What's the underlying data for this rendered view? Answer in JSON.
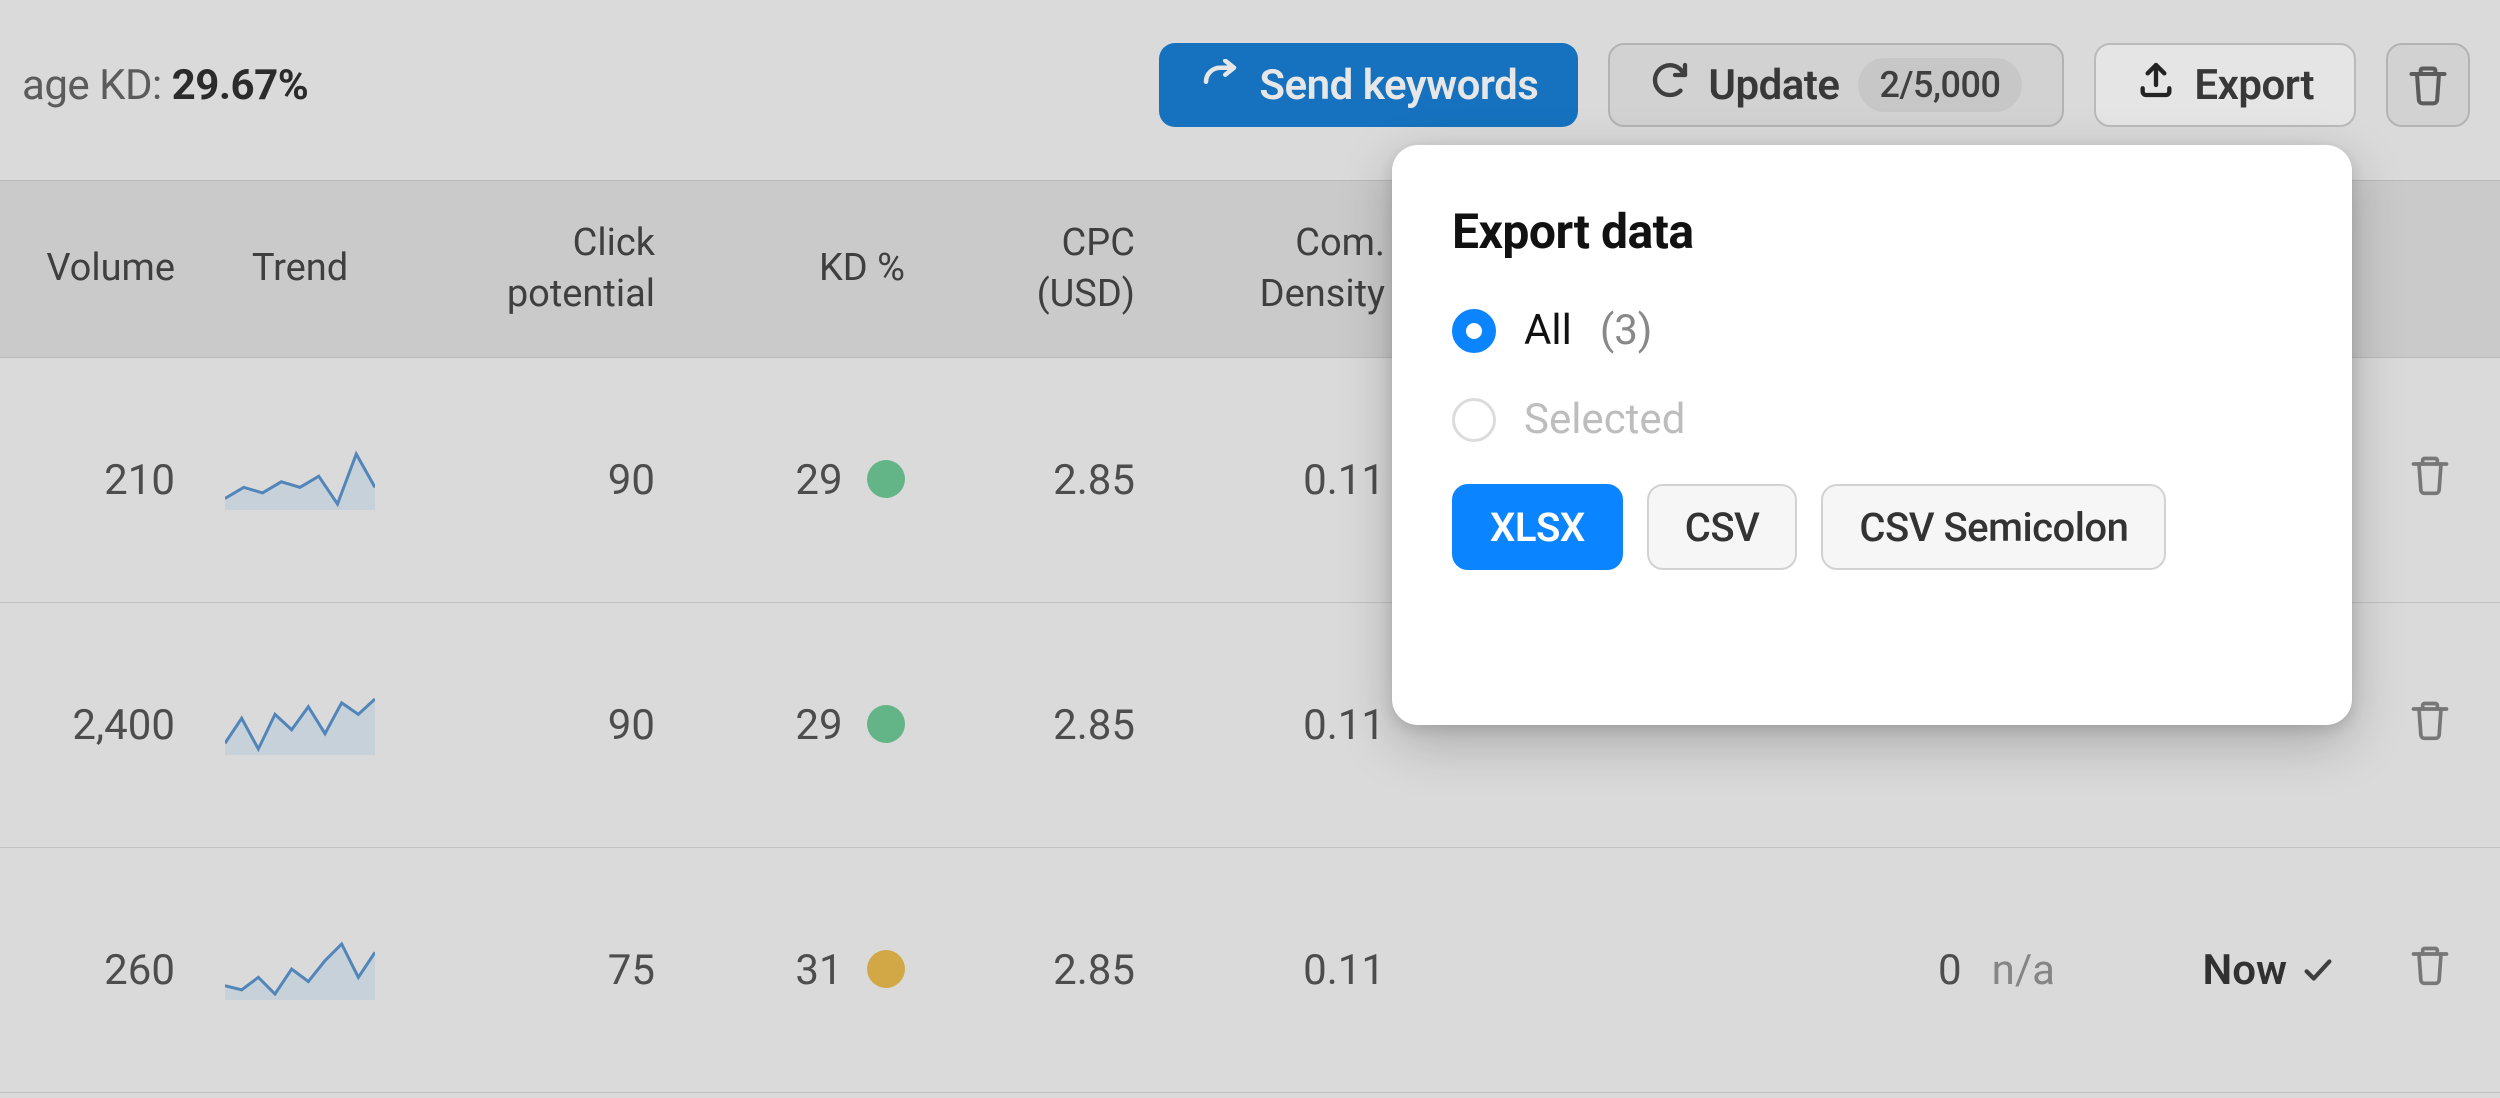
{
  "header": {
    "avg_kd_label": "age KD: ",
    "avg_kd_value": "29.67%"
  },
  "toolbar": {
    "send_label": "Send keywords",
    "update_label": "Update",
    "update_count": "2/5,000",
    "export_label": "Export"
  },
  "columns": {
    "volume": "Volume",
    "trend": "Trend",
    "click": "Click potential",
    "kd": "KD %",
    "cpc": "CPC (USD)",
    "com": "Com. Density"
  },
  "rows": [
    {
      "volume": "210",
      "click": "90",
      "kd": "29",
      "kd_color": "green",
      "cpc": "2.85",
      "com": "0.11",
      "misc_num": "",
      "misc_txt": "",
      "now": "",
      "trend": [
        20,
        22,
        21,
        23,
        22,
        24,
        19,
        28,
        22
      ]
    },
    {
      "volume": "2,400",
      "click": "90",
      "kd": "29",
      "kd_color": "green",
      "cpc": "2.85",
      "com": "0.11",
      "misc_num": "",
      "misc_txt": "",
      "now": "",
      "trend": [
        15,
        28,
        12,
        30,
        22,
        34,
        20,
        36,
        30,
        38
      ]
    },
    {
      "volume": "260",
      "click": "75",
      "kd": "31",
      "kd_color": "yellow",
      "cpc": "2.85",
      "com": "0.11",
      "misc_num": "0",
      "misc_txt": "n/a",
      "now": "Now",
      "trend": [
        18,
        16,
        22,
        14,
        26,
        20,
        30,
        38,
        22,
        34
      ]
    }
  ],
  "popover": {
    "title": "Export data",
    "all_label": "All",
    "all_count": "(3)",
    "selected_label": "Selected",
    "formats": {
      "xlsx": "XLSX",
      "csv": "CSV",
      "csvsemi": "CSV Semicolon"
    }
  }
}
